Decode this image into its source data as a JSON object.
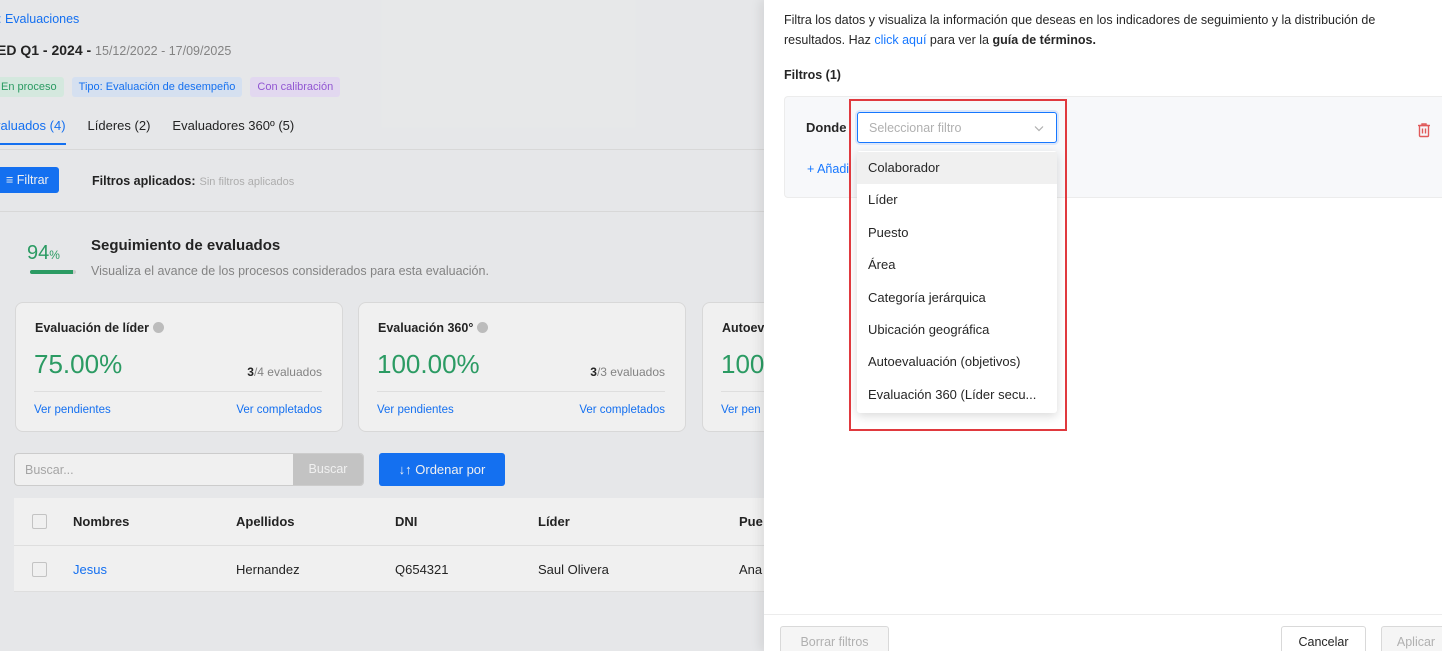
{
  "background": {
    "breadcrumb": ": Evaluaciones",
    "title": {
      "name": "ED Q1 - 2024 - ",
      "dates": "15/12/2022 - 17/09/2025"
    },
    "tags": {
      "status": "En proceso",
      "type": "Tipo: Evaluación de desempeño",
      "calibration": "Con calibración"
    },
    "tabs": [
      "valuados (4)",
      "Líderes (2)",
      "Evaluadores 360º (5)"
    ],
    "filter_button": "Filtrar",
    "applied_label": "Filtros aplicados:",
    "applied_value": "Sin filtros aplicados",
    "tracking": {
      "percent_value": "94",
      "percent_unit": "%",
      "progress": 0.94,
      "title": "Seguimiento de evaluados",
      "subtitle": "Visualiza el avance de los procesos considerados para esta evaluación."
    },
    "cards": [
      {
        "title": "Evaluación de líder",
        "percent": "75.00%",
        "done": "3",
        "total": "/4 evaluados",
        "pending": "Ver pendientes",
        "completed": "Ver completados"
      },
      {
        "title": "Evaluación 360°",
        "percent": "100.00%",
        "done": "3",
        "total": "/3 evaluados",
        "pending": "Ver pendientes",
        "completed": "Ver completados"
      },
      {
        "title": "Autoev",
        "percent": "100",
        "pending": "Ver pen"
      }
    ],
    "search_placeholder": "Buscar...",
    "search_button": "Buscar",
    "sort_button": "Ordenar por",
    "table": {
      "headers": [
        "Nombres",
        "Apellidos",
        "DNI",
        "Líder",
        "Pue"
      ],
      "rows": [
        [
          "Jesus",
          "Hernandez",
          "Q654321",
          "Saul Olivera",
          "Ana"
        ]
      ]
    }
  },
  "drawer": {
    "description_1": "Filtra los datos y visualiza la información que deseas en los indicadores de seguimiento y la distribución de",
    "description_2": "resultados. Haz ",
    "description_link": "click aquí",
    "description_3": " para ver la ",
    "description_bold": "guía de términos.",
    "filters_title": "Filtros (1)",
    "where_label": "Donde",
    "select_placeholder": "Seleccionar filtro",
    "add_link": "+ Añadi",
    "options": [
      "Colaborador",
      "Líder",
      "Puesto",
      "Área",
      "Categoría jerárquica",
      "Ubicación geográfica",
      "Autoevaluación (objetivos)",
      "Evaluación 360 (Líder secu..."
    ],
    "footer": {
      "clear": "Borrar filtros",
      "cancel": "Cancelar",
      "apply": "Aplicar"
    }
  },
  "colors": {
    "accent": "#1677ff",
    "success": "#2ea56a",
    "highlight": "#e0393e",
    "danger": "#e05a5a"
  }
}
